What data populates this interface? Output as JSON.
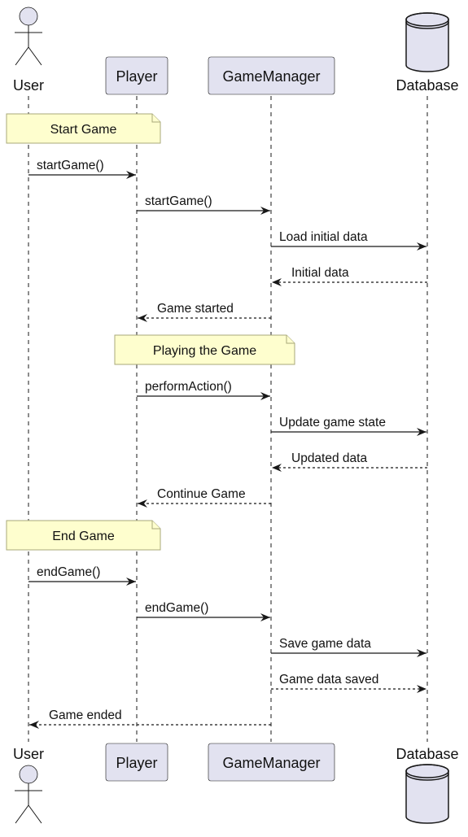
{
  "participants": [
    {
      "id": "user",
      "label": "User",
      "kind": "actor"
    },
    {
      "id": "player",
      "label": "Player",
      "kind": "participant"
    },
    {
      "id": "gm",
      "label": "GameManager",
      "kind": "participant"
    },
    {
      "id": "db",
      "label": "Database",
      "kind": "database"
    }
  ],
  "sequence": [
    {
      "type": "note",
      "text": "Start Game",
      "over": [
        "user",
        "player"
      ]
    },
    {
      "type": "message",
      "from": "user",
      "to": "player",
      "text": "startGame()",
      "style": "solid"
    },
    {
      "type": "message",
      "from": "player",
      "to": "gm",
      "text": "startGame()",
      "style": "solid"
    },
    {
      "type": "message",
      "from": "gm",
      "to": "db",
      "text": "Load initial data",
      "style": "solid"
    },
    {
      "type": "message",
      "from": "db",
      "to": "gm",
      "text": "Initial data",
      "style": "dashed"
    },
    {
      "type": "message",
      "from": "gm",
      "to": "player",
      "text": "Game started",
      "style": "dashed"
    },
    {
      "type": "note",
      "text": "Playing the Game",
      "over": [
        "player",
        "gm"
      ]
    },
    {
      "type": "message",
      "from": "player",
      "to": "gm",
      "text": "performAction()",
      "style": "solid"
    },
    {
      "type": "message",
      "from": "gm",
      "to": "db",
      "text": "Update game state",
      "style": "solid"
    },
    {
      "type": "message",
      "from": "db",
      "to": "gm",
      "text": "Updated data",
      "style": "dashed"
    },
    {
      "type": "message",
      "from": "gm",
      "to": "player",
      "text": "Continue Game",
      "style": "dashed"
    },
    {
      "type": "note",
      "text": "End Game",
      "over": [
        "user",
        "player"
      ]
    },
    {
      "type": "message",
      "from": "user",
      "to": "player",
      "text": "endGame()",
      "style": "solid"
    },
    {
      "type": "message",
      "from": "player",
      "to": "gm",
      "text": "endGame()",
      "style": "solid"
    },
    {
      "type": "message",
      "from": "gm",
      "to": "db",
      "text": "Save game data",
      "style": "solid"
    },
    {
      "type": "message",
      "from": "gm",
      "to": "db",
      "text": "Game data saved",
      "style": "dashed"
    },
    {
      "type": "message",
      "from": "gm",
      "to": "user",
      "text": "Game ended",
      "style": "dashed"
    }
  ],
  "colors": {
    "participant_fill": "#e2e2f0",
    "note_fill": "#fefece",
    "line": "#181818"
  }
}
